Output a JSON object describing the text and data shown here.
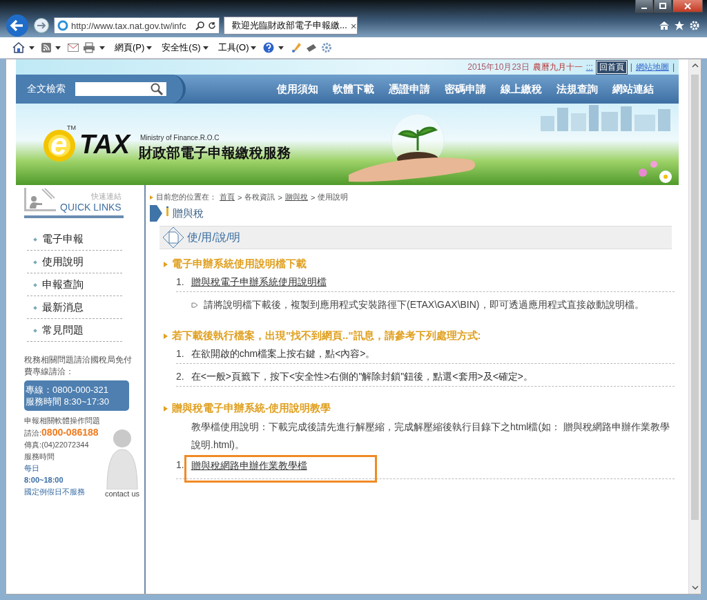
{
  "browser": {
    "address": "http://www.tax.nat.gov.tw/infc",
    "tab_title": "歡迎光臨財政部電子申報繳...",
    "tab_close": "×",
    "menus": [
      "網頁(P)",
      "安全性(S)",
      "工具(O)"
    ]
  },
  "top_bar": {
    "date": "2015年10月23日",
    "lunar": "農曆九月十一",
    "separator": ":::",
    "home": "回首頁",
    "divider": "|",
    "sitemap": "網站地圖",
    "divider_end": "|"
  },
  "search": {
    "label": "全文檢索"
  },
  "nav": [
    "使用須知",
    "軟體下載",
    "憑證申請",
    "密碼申請",
    "線上繳稅",
    "法規查詢",
    "網站連結"
  ],
  "banner": {
    "logo_e": "e",
    "logo_tm": "TM",
    "logo_tax": "TAX",
    "ministry": "Ministry of Finance.R.O.C",
    "service": "財政部電子申報繳稅服務"
  },
  "sidebar": {
    "quick_zh": "快速連結",
    "quick_en": "QUICK LINKS",
    "items": [
      "電子申報",
      "使用說明",
      "申報查詢",
      "最新消息",
      "常見問題"
    ],
    "tax_note": "稅務相關問題請洽國稅局免付費專線請洽：",
    "hotline": "專線：0800-000-321",
    "hotline_hours": "服務時間 8:30~17:30",
    "software_note": "申報相關軟體操作問題",
    "contact_label": "請洽:",
    "software_phone": "0800-086188",
    "fax": "傳真:(04)22072344",
    "hours_label": "服務時間",
    "days": "每日",
    "hours": "8:00~18:00",
    "holiday": "國定例假日不服務",
    "contact_us": "contact us"
  },
  "breadcrumb": {
    "label": "目前您的位置在：",
    "separator": ">",
    "items": [
      {
        "text": "首頁",
        "link": true
      },
      {
        "text": "各稅資訊",
        "link": false
      },
      {
        "text": "贈與稅",
        "link": true
      },
      {
        "text": "使用說明",
        "link": false
      }
    ]
  },
  "section_title": "贈與稅",
  "heading": "使/用/說/明",
  "sections": [
    {
      "title": "電子申辦系統使用說明檔下載",
      "blocks": [
        {
          "kind": "numbered",
          "number": "1.",
          "text": "贈與稅電子申辦系統使用說明檔",
          "link": true,
          "highlighted": false
        },
        {
          "kind": "note",
          "text": "請將說明檔下載後，複製到應用程式安裝路徑下(ETAX\\GAX\\BIN)，即可透過應用程式直接啟動說明檔。"
        }
      ]
    },
    {
      "title": "若下載後執行檔案，出現\"找不到網頁..\"訊息，請參考下列處理方式:",
      "blocks": [
        {
          "kind": "numbered",
          "number": "1.",
          "text": "在欲開啟的chm檔案上按右鍵，點<內容>。",
          "link": false,
          "highlighted": false
        },
        {
          "kind": "numbered",
          "number": "2.",
          "text": "在<一般>頁籤下，按下<安全性>右側的\"解除封鎖\"鈕後，點選<套用>及<確定>。",
          "link": false,
          "highlighted": false
        }
      ]
    },
    {
      "title": "贈與稅電子申辦系統-使用說明教學",
      "blocks": [
        {
          "kind": "paragraph",
          "text": "教學檔使用說明：下載完成後請先進行解壓縮，完成解壓縮後執行目錄下之html檔(如： 贈與稅網路申辦作業教學說明.html)。"
        },
        {
          "kind": "numbered",
          "number": "1.",
          "text": "贈與稅網路申辦作業教學檔",
          "link": true,
          "highlighted": true
        }
      ]
    }
  ]
}
